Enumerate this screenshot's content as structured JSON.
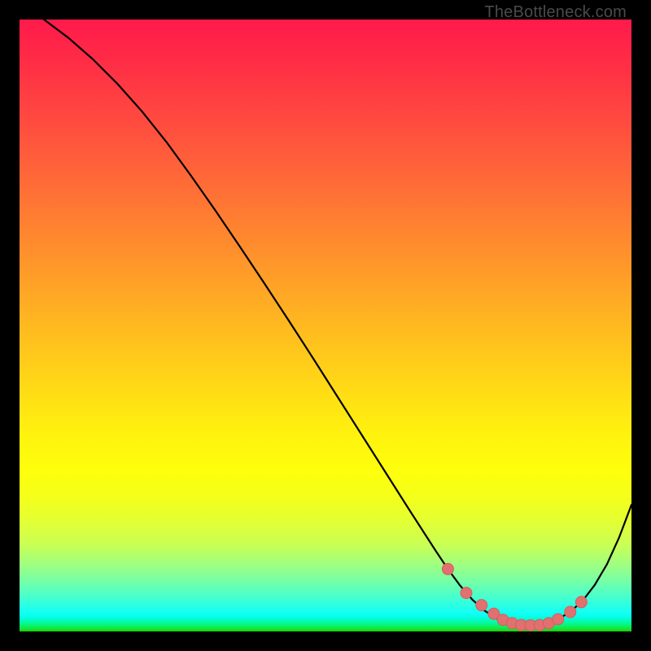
{
  "watermark": "TheBottleneck.com",
  "colors": {
    "background": "#000000",
    "curve": "#000000",
    "marker_fill": "#e17070",
    "marker_stroke": "#d85d5d"
  },
  "chart_data": {
    "type": "line",
    "title": "",
    "xlabel": "",
    "ylabel": "",
    "xlim": [
      0,
      100
    ],
    "ylim": [
      0,
      100
    ],
    "grid": false,
    "series": [
      {
        "name": "bottleneck-curve",
        "x": [
          0,
          4,
          8,
          12,
          16,
          20,
          24,
          28,
          32,
          36,
          40,
          44,
          48,
          52,
          56,
          60,
          64,
          68,
          70,
          72,
          74,
          76,
          78,
          80,
          82,
          84,
          86,
          88,
          90,
          92,
          94,
          96,
          98,
          100
        ],
        "values": [
          103,
          100,
          97,
          93.5,
          89.5,
          85,
          80,
          74.5,
          68.8,
          62.9,
          56.9,
          50.8,
          44.6,
          38.3,
          32,
          25.7,
          19.4,
          13.2,
          10.2,
          7.5,
          5.2,
          3.4,
          2.1,
          1.3,
          1.0,
          1.0,
          1.3,
          2.0,
          3.2,
          5.0,
          7.6,
          11.0,
          15.4,
          20.7
        ]
      }
    ],
    "markers": {
      "name": "highlighted-points",
      "x": [
        70,
        73,
        75.5,
        77.5,
        79,
        80.5,
        82,
        83.5,
        85,
        86.5,
        88,
        90,
        91.8
      ],
      "values": [
        10.2,
        6.3,
        4.3,
        2.9,
        1.9,
        1.35,
        1.05,
        1.0,
        1.05,
        1.35,
        2.0,
        3.2,
        4.8
      ]
    }
  }
}
